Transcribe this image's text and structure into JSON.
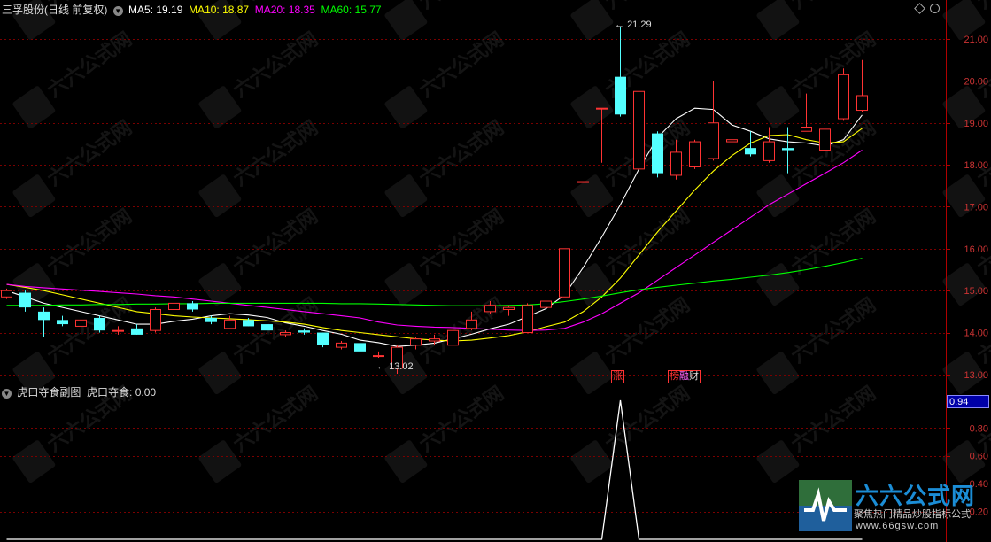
{
  "main_panel": {
    "title": "三孚股份(日线 前复权)",
    "ma_labels": [
      {
        "text": "MA5: 19.19",
        "color": "#ffffff"
      },
      {
        "text": "MA10: 18.87",
        "color": "#ffff00"
      },
      {
        "text": "MA20: 18.35",
        "color": "#ff00ff"
      },
      {
        "text": "MA60: 15.77",
        "color": "#00ff00"
      }
    ],
    "high_label": "21.29",
    "low_label": "13.02",
    "event_tags": [
      "涨",
      "榜",
      "融",
      "财"
    ]
  },
  "sub_panel": {
    "title": "虎口夺食副图",
    "indicator_label": "虎口夺食: 0.00",
    "current_value_badge": "0.94"
  },
  "watermark": {
    "brand": "六六公式网",
    "slogan": "聚焦热门精品炒股指标公式",
    "url": "www.66gsw.com"
  },
  "colors": {
    "up": "#ff3333",
    "down": "#54ffff",
    "grid": "#7a0000",
    "axis_text": "#cc3333",
    "ma5": "#ffffff",
    "ma10": "#ffff00",
    "ma20": "#ff00ff",
    "ma60": "#00ff00"
  },
  "chart_data": [
    {
      "type": "candlestick",
      "title": "三孚股份(日线 前复权)",
      "yticks": [
        13.0,
        14.0,
        15.0,
        16.0,
        17.0,
        18.0,
        19.0,
        20.0,
        21.0
      ],
      "ylim": [
        12.85,
        21.55
      ],
      "grid": true,
      "candles": [
        {
          "o": 14.85,
          "h": 15.05,
          "l": 14.8,
          "c": 15.0
        },
        {
          "o": 14.95,
          "h": 15.0,
          "l": 14.5,
          "c": 14.6
        },
        {
          "o": 14.5,
          "h": 14.6,
          "l": 13.9,
          "c": 14.3
        },
        {
          "o": 14.3,
          "h": 14.4,
          "l": 14.15,
          "c": 14.2
        },
        {
          "o": 14.15,
          "h": 14.35,
          "l": 14.05,
          "c": 14.3
        },
        {
          "o": 14.35,
          "h": 14.4,
          "l": 14.0,
          "c": 14.05
        },
        {
          "o": 14.05,
          "h": 14.15,
          "l": 13.95,
          "c": 14.05
        },
        {
          "o": 14.1,
          "h": 14.2,
          "l": 13.95,
          "c": 13.95
        },
        {
          "o": 14.05,
          "h": 14.6,
          "l": 14.0,
          "c": 14.55
        },
        {
          "o": 14.55,
          "h": 14.75,
          "l": 14.5,
          "c": 14.7
        },
        {
          "o": 14.7,
          "h": 14.75,
          "l": 14.5,
          "c": 14.55
        },
        {
          "o": 14.35,
          "h": 14.4,
          "l": 14.2,
          "c": 14.25
        },
        {
          "o": 14.1,
          "h": 14.4,
          "l": 14.1,
          "c": 14.3
        },
        {
          "o": 14.3,
          "h": 14.35,
          "l": 14.15,
          "c": 14.15
        },
        {
          "o": 14.2,
          "h": 14.25,
          "l": 14.0,
          "c": 14.05
        },
        {
          "o": 13.95,
          "h": 14.05,
          "l": 13.9,
          "c": 14.0
        },
        {
          "o": 14.05,
          "h": 14.1,
          "l": 13.95,
          "c": 14.0
        },
        {
          "o": 14.0,
          "h": 14.0,
          "l": 13.65,
          "c": 13.7
        },
        {
          "o": 13.65,
          "h": 13.8,
          "l": 13.6,
          "c": 13.75
        },
        {
          "o": 13.75,
          "h": 13.75,
          "l": 13.45,
          "c": 13.55
        },
        {
          "o": 13.45,
          "h": 13.55,
          "l": 13.4,
          "c": 13.45
        },
        {
          "o": 13.15,
          "h": 13.7,
          "l": 13.02,
          "c": 13.65
        },
        {
          "o": 13.7,
          "h": 13.9,
          "l": 13.6,
          "c": 13.85
        },
        {
          "o": 13.8,
          "h": 13.95,
          "l": 13.7,
          "c": 13.85
        },
        {
          "o": 13.7,
          "h": 14.1,
          "l": 13.7,
          "c": 14.05
        },
        {
          "o": 14.1,
          "h": 14.5,
          "l": 14.05,
          "c": 14.3
        },
        {
          "o": 14.5,
          "h": 14.75,
          "l": 14.45,
          "c": 14.65
        },
        {
          "o": 14.55,
          "h": 14.65,
          "l": 14.4,
          "c": 14.6
        },
        {
          "o": 14.0,
          "h": 14.7,
          "l": 14.0,
          "c": 14.65
        },
        {
          "o": 14.6,
          "h": 14.85,
          "l": 14.55,
          "c": 14.75
        },
        {
          "o": 14.85,
          "h": 16.0,
          "l": 14.85,
          "c": 16.0
        },
        {
          "o": 17.6,
          "h": 17.6,
          "l": 17.6,
          "c": 17.6
        },
        {
          "o": 19.35,
          "h": 19.35,
          "l": 18.05,
          "c": 19.35
        },
        {
          "o": 20.1,
          "h": 21.29,
          "l": 19.15,
          "c": 19.2
        },
        {
          "o": 17.9,
          "h": 20.0,
          "l": 17.5,
          "c": 19.75
        },
        {
          "o": 18.75,
          "h": 18.8,
          "l": 17.7,
          "c": 17.8
        },
        {
          "o": 17.75,
          "h": 18.6,
          "l": 17.65,
          "c": 18.3
        },
        {
          "o": 17.95,
          "h": 18.6,
          "l": 17.9,
          "c": 18.55
        },
        {
          "o": 18.15,
          "h": 20.0,
          "l": 18.1,
          "c": 19.0
        },
        {
          "o": 18.55,
          "h": 19.4,
          "l": 18.5,
          "c": 18.6
        },
        {
          "o": 18.4,
          "h": 18.8,
          "l": 18.2,
          "c": 18.25
        },
        {
          "o": 18.1,
          "h": 18.9,
          "l": 18.05,
          "c": 18.55
        },
        {
          "o": 18.4,
          "h": 18.9,
          "l": 17.8,
          "c": 18.35
        },
        {
          "o": 18.8,
          "h": 19.7,
          "l": 18.8,
          "c": 18.9
        },
        {
          "o": 18.35,
          "h": 19.4,
          "l": 18.3,
          "c": 18.85
        },
        {
          "o": 19.1,
          "h": 20.3,
          "l": 19.05,
          "c": 20.15
        },
        {
          "o": 19.3,
          "h": 20.5,
          "l": 19.25,
          "c": 19.65
        }
      ],
      "series": [
        {
          "name": "MA5",
          "values": [
            15.0,
            14.85,
            14.7,
            14.6,
            14.5,
            14.4,
            14.3,
            14.2,
            14.2,
            14.27,
            14.32,
            14.4,
            14.45,
            14.42,
            14.36,
            14.23,
            14.15,
            14.05,
            13.96,
            13.82,
            13.76,
            13.67,
            13.7,
            13.75,
            13.85,
            13.96,
            14.09,
            14.2,
            14.38,
            14.57,
            14.9,
            15.55,
            16.28,
            17.05,
            17.9,
            18.65,
            19.1,
            19.35,
            19.32,
            18.95,
            18.8,
            18.62,
            18.55,
            18.52,
            18.45,
            18.6,
            19.19
          ]
        },
        {
          "name": "MA10",
          "values": [
            15.15,
            15.08,
            15.0,
            14.9,
            14.8,
            14.7,
            14.6,
            14.5,
            14.45,
            14.4,
            14.37,
            14.35,
            14.33,
            14.31,
            14.28,
            14.25,
            14.2,
            14.12,
            14.05,
            14.0,
            13.95,
            13.9,
            13.85,
            13.82,
            13.8,
            13.82,
            13.87,
            13.93,
            14.02,
            14.14,
            14.25,
            14.5,
            14.85,
            15.3,
            15.85,
            16.4,
            16.9,
            17.4,
            17.85,
            18.22,
            18.52,
            18.7,
            18.72,
            18.6,
            18.52,
            18.55,
            18.87
          ]
        },
        {
          "name": "MA20",
          "values": [
            15.15,
            15.1,
            15.07,
            15.04,
            15.01,
            14.98,
            14.95,
            14.92,
            14.88,
            14.85,
            14.8,
            14.75,
            14.7,
            14.65,
            14.6,
            14.55,
            14.5,
            14.45,
            14.4,
            14.35,
            14.25,
            14.18,
            14.15,
            14.13,
            14.12,
            14.1,
            14.08,
            14.06,
            14.05,
            14.06,
            14.1,
            14.25,
            14.45,
            14.7,
            14.95,
            15.25,
            15.55,
            15.85,
            16.15,
            16.45,
            16.75,
            17.05,
            17.3,
            17.55,
            17.8,
            18.05,
            18.35
          ]
        },
        {
          "name": "MA60",
          "values": [
            14.65,
            14.65,
            14.65,
            14.66,
            14.66,
            14.67,
            14.67,
            14.68,
            14.68,
            14.69,
            14.69,
            14.7,
            14.7,
            14.7,
            14.7,
            14.7,
            14.7,
            14.7,
            14.69,
            14.69,
            14.68,
            14.67,
            14.66,
            14.65,
            14.64,
            14.64,
            14.64,
            14.65,
            14.66,
            14.69,
            14.74,
            14.8,
            14.87,
            14.95,
            15.02,
            15.08,
            15.13,
            15.18,
            15.23,
            15.27,
            15.32,
            15.37,
            15.43,
            15.5,
            15.58,
            15.67,
            15.77
          ]
        }
      ]
    },
    {
      "type": "line",
      "title": "虎口夺食副图",
      "yticks": [
        0.2,
        0.4,
        0.6,
        0.8
      ],
      "ylim": [
        0.0,
        1.05
      ],
      "series": [
        {
          "name": "虎口夺食",
          "values": [
            0,
            0,
            0,
            0,
            0,
            0,
            0,
            0,
            0,
            0,
            0,
            0,
            0,
            0,
            0,
            0,
            0,
            0,
            0,
            0,
            0,
            0,
            0,
            0,
            0,
            0,
            0,
            0,
            0,
            0,
            0,
            0,
            0,
            1,
            0,
            0,
            0,
            0,
            0,
            0,
            0,
            0,
            0,
            0,
            0,
            0,
            0
          ]
        }
      ]
    }
  ]
}
